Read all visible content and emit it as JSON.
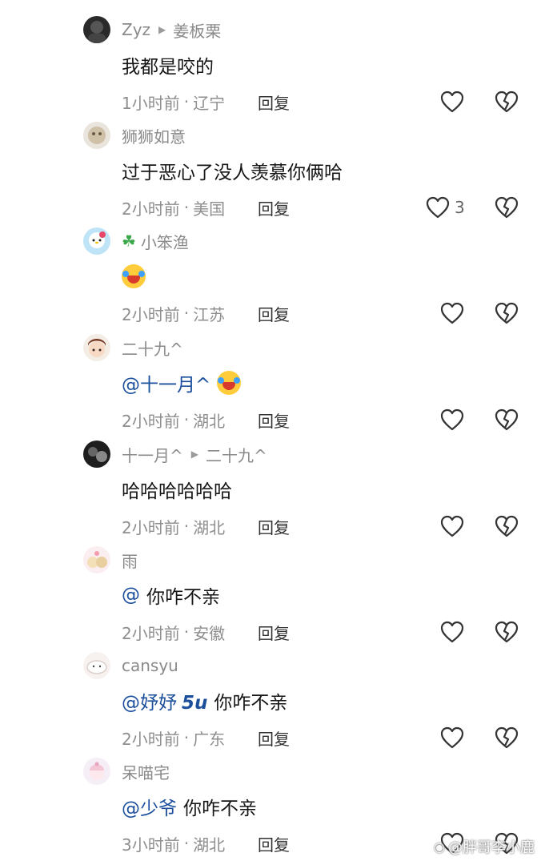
{
  "comments": [
    {
      "user": "Zyz",
      "reply_to": "姜板栗",
      "text": "我都是咬的",
      "time": "1小时前",
      "location": "辽宁",
      "likes": "",
      "reply_label": "回复"
    },
    {
      "user": "狮狮如意",
      "reply_to": "",
      "text": "过于恶心了没人羡慕你俩哈",
      "time": "2小时前",
      "location": "美国",
      "likes": "3",
      "reply_label": "回复"
    },
    {
      "user": "小笨渔",
      "reply_to": "",
      "text": "",
      "time": "2小时前",
      "location": "江苏",
      "likes": "",
      "reply_label": "回复"
    },
    {
      "user": "二十九^",
      "reply_to": "",
      "mention": "@十一月^",
      "text": "",
      "time": "2小时前",
      "location": "湖北",
      "likes": "",
      "reply_label": "回复"
    },
    {
      "user": "十一月^",
      "reply_to": "二十九^",
      "text": "哈哈哈哈哈哈",
      "time": "2小时前",
      "location": "湖北",
      "likes": "",
      "reply_label": "回复"
    },
    {
      "user": "雨",
      "reply_to": "",
      "mention": "@",
      "text": "你咋不亲",
      "time": "2小时前",
      "location": "安徽",
      "likes": "",
      "reply_label": "回复"
    },
    {
      "user": "cansyu",
      "reply_to": "",
      "mention": "@妤妤",
      "mention_suffix": "5u",
      "text": "你咋不亲",
      "time": "2小时前",
      "location": "广东",
      "likes": "",
      "reply_label": "回复"
    },
    {
      "user": "呆喵宅",
      "reply_to": "",
      "mention": "@少爷",
      "text": "你咋不亲",
      "time": "3小时前",
      "location": "湖北",
      "likes": "",
      "reply_label": "回复"
    }
  ],
  "separator": "·",
  "watermark": "@胖哥李小鹿",
  "icons": {
    "like": "heart-outline-icon",
    "dislike": "broken-heart-icon",
    "reply_arrow": "triangle-right-icon"
  }
}
